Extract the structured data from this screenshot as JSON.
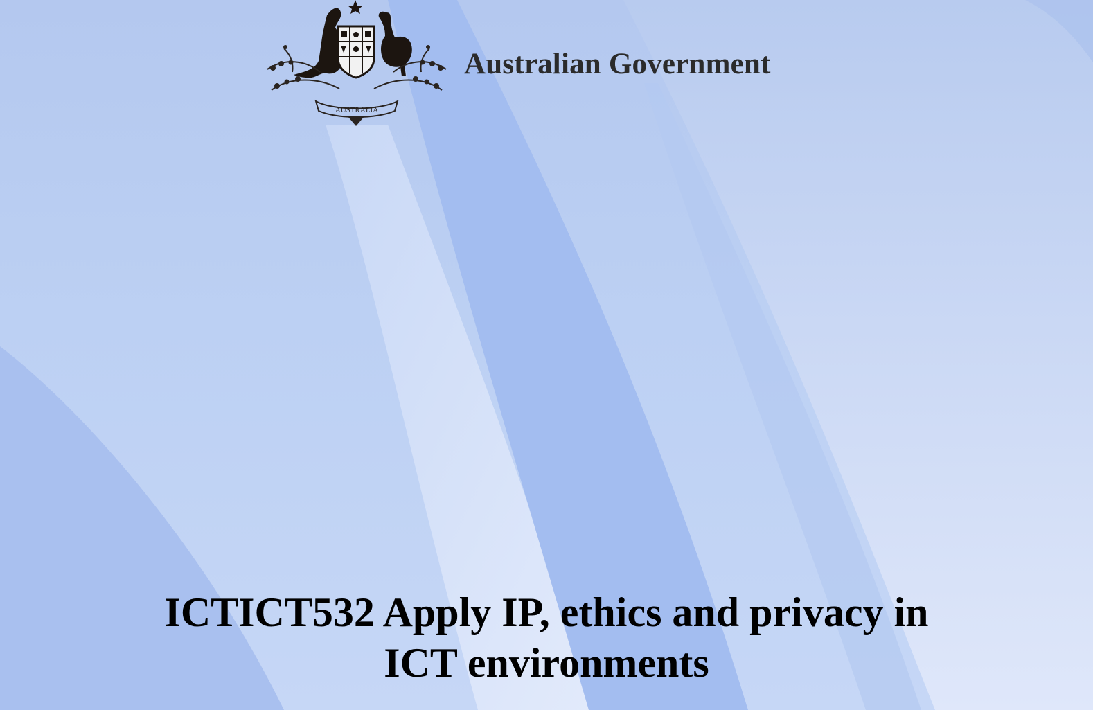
{
  "header": {
    "crest_motto": "AUSTRALIA",
    "government_name": "Australian Government"
  },
  "document": {
    "title_line1": "ICTICT532 Apply IP, ethics and privacy in",
    "title_line2": "ICT environments"
  },
  "colors": {
    "background": "#bcd0f3",
    "band_dark": "#a2bcef",
    "band_light": "#dbe5fa",
    "text": "#000000"
  }
}
